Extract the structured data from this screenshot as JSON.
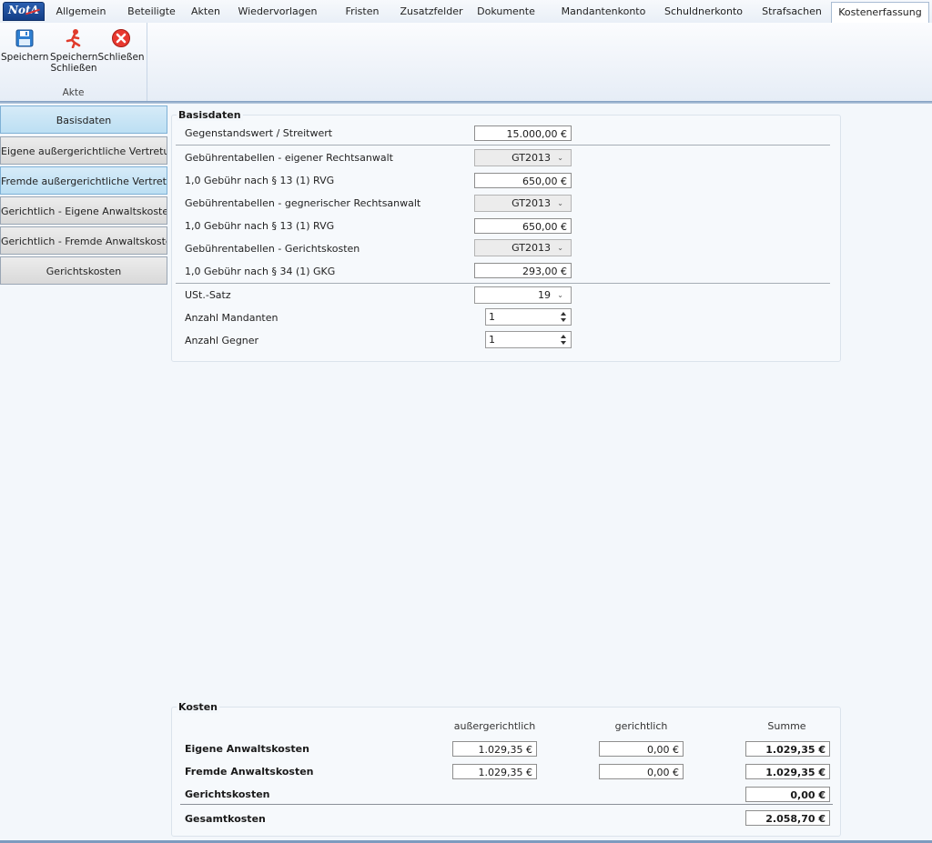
{
  "app": {
    "logo": "NotA"
  },
  "tabs": [
    {
      "label": "Allgemein"
    },
    {
      "label": "Beteiligte"
    },
    {
      "label": "Akten"
    },
    {
      "label": "Wiedervorlagen"
    },
    {
      "label": "Fristen"
    },
    {
      "label": "Zusatzfelder"
    },
    {
      "label": "Dokumente"
    },
    {
      "label": "Mandantenkonto"
    },
    {
      "label": "Schuldnerkonto"
    },
    {
      "label": "Strafsachen"
    },
    {
      "label": "Kostenerfassung"
    }
  ],
  "ribbon": {
    "save_label": "Speichern",
    "save_close_label": "Speichern Schließen",
    "close_label": "Schließen",
    "group_label": "Akte"
  },
  "nav": [
    {
      "label": "Basisdaten"
    },
    {
      "label": "Eigene außergerichtliche Vertretung"
    },
    {
      "label": "Fremde außergerichtliche Vertretung"
    },
    {
      "label": "Gerichtlich - Eigene Anwaltskosten"
    },
    {
      "label": "Gerichtlich - Fremde Anwaltskosten"
    },
    {
      "label": "Gerichtskosten"
    }
  ],
  "basisdaten": {
    "title": "Basisdaten",
    "gegenstandswert_label": "Gegenstandswert / Streitwert",
    "gegenstandswert_value": "15.000,00 €",
    "gt_eigen_label": "Gebührentabellen - eigener Rechtsanwalt",
    "gt_eigen_value": "GT2013",
    "geb_eigen_label": "1,0 Gebühr nach § 13 (1) RVG",
    "geb_eigen_value": "650,00 €",
    "gt_gegner_label": "Gebührentabellen - gegnerischer Rechtsanwalt",
    "gt_gegner_value": "GT2013",
    "geb_gegner_label": "1,0 Gebühr nach § 13 (1) RVG",
    "geb_gegner_value": "650,00 €",
    "gt_gericht_label": "Gebührentabellen - Gerichtskosten",
    "gt_gericht_value": "GT2013",
    "geb_gericht_label": "1,0 Gebühr nach § 34 (1) GKG",
    "geb_gericht_value": "293,00 €",
    "ust_label": "USt.-Satz",
    "ust_value": "19",
    "mandanten_label": "Anzahl Mandanten",
    "mandanten_value": "1",
    "gegner_label": "Anzahl Gegner",
    "gegner_value": "1"
  },
  "kosten": {
    "title": "Kosten",
    "col_ausser": "außergerichtlich",
    "col_gericht": "gerichtlich",
    "col_summe": "Summe",
    "eigene_label": "Eigene Anwaltskosten",
    "eigene_ausser": "1.029,35 €",
    "eigene_gericht": "0,00 €",
    "eigene_summe": "1.029,35 €",
    "fremde_label": "Fremde Anwaltskosten",
    "fremde_ausser": "1.029,35 €",
    "fremde_gericht": "0,00 €",
    "fremde_summe": "1.029,35 €",
    "gerichtskosten_label": "Gerichtskosten",
    "gerichtskosten_summe": "0,00 €",
    "gesamt_label": "Gesamtkosten",
    "gesamt_summe": "2.058,70 €"
  }
}
